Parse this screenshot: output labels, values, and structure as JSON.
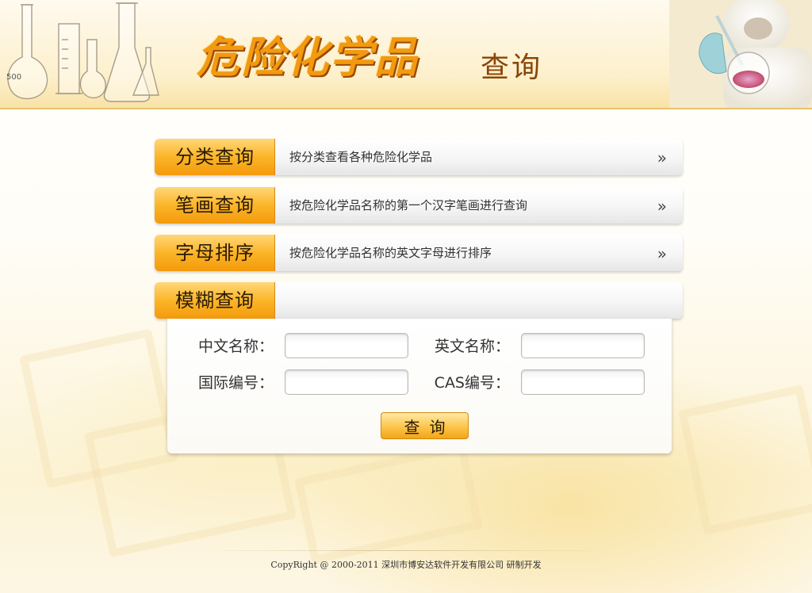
{
  "header": {
    "title_main": "危险化学品",
    "title_sub": "查询"
  },
  "menu": [
    {
      "tab": "分类查询",
      "desc": "按分类查看各种危险化学品",
      "arrow": "»"
    },
    {
      "tab": "笔画查询",
      "desc": "按危险化学品名称的第一个汉字笔画进行查询",
      "arrow": "»"
    },
    {
      "tab": "字母排序",
      "desc": "按危险化学品名称的英文字母进行排序",
      "arrow": "»"
    },
    {
      "tab": "模糊查询",
      "desc": "",
      "arrow": ""
    }
  ],
  "search": {
    "chinese_name_label": "中文名称：",
    "english_name_label": "英文名称：",
    "intl_code_label": "国际编号：",
    "cas_code_label": "CAS编号：",
    "chinese_name_value": "",
    "english_name_value": "",
    "intl_code_value": "",
    "cas_code_value": "",
    "button_label": "查询"
  },
  "footer": {
    "text": "CopyRight @ 2000-2011 深圳市博安达软件开发有限公司 研制开发"
  },
  "colors": {
    "accent_orange": "#f39a0c",
    "title_orange": "#f29a10",
    "title_brown": "#8a4608"
  }
}
